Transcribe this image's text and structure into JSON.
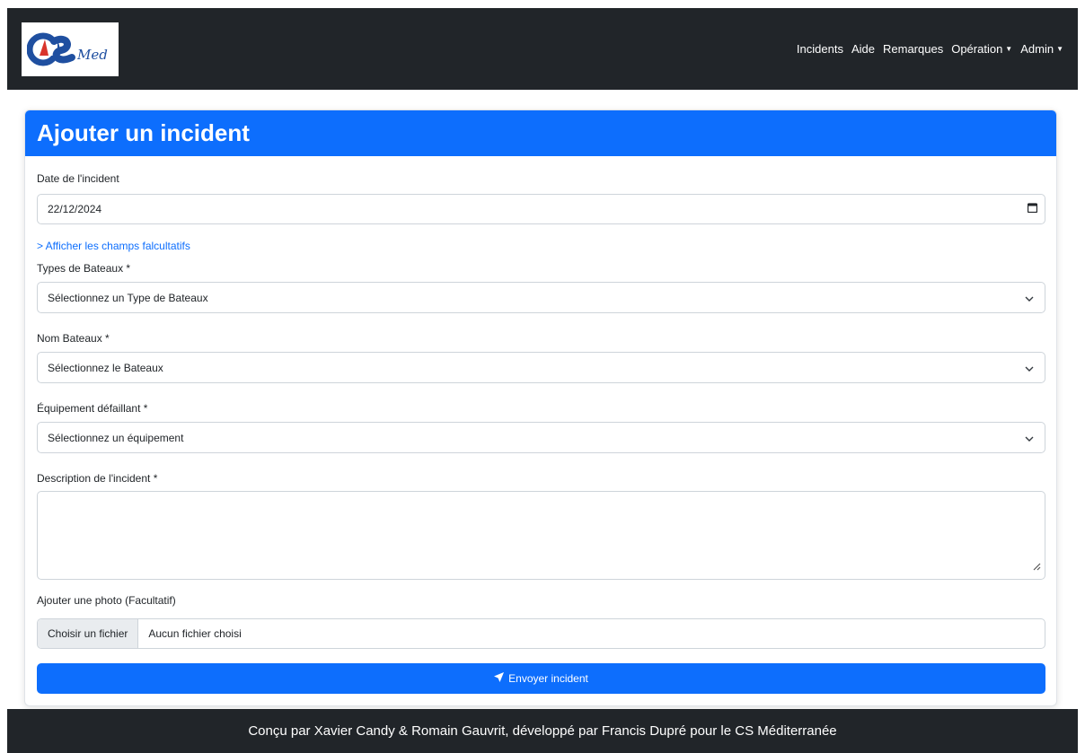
{
  "navbar": {
    "logo_text": "CS Med",
    "links": [
      {
        "label": "Incidents"
      },
      {
        "label": "Aide"
      },
      {
        "label": "Remarques"
      },
      {
        "label": "Opération"
      },
      {
        "label": "Admin"
      }
    ]
  },
  "form": {
    "title": "Ajouter un incident",
    "date_label": "Date de l'incident",
    "date_value": "22/12/2024",
    "optional_link": "> Afficher les champs falcultatifs",
    "boat_type_label": "Types de Bateaux *",
    "boat_type_value": "Sélectionnez un Type de Bateaux",
    "boat_name_label": "Nom Bateaux *",
    "boat_name_value": "Sélectionnez le Bateaux",
    "equipment_label": "Équipement défaillant *",
    "equipment_value": "Sélectionnez un équipement",
    "description_label": "Description de l'incident *",
    "description_value": "",
    "photo_label": "Ajouter une photo (Facultatif)",
    "file_button": "Choisir un fichier",
    "file_status": "Aucun fichier choisi",
    "submit_label": "Envoyer incident"
  },
  "footer": {
    "text": "Conçu par Xavier Candy & Romain Gauvrit, développé par Francis Dupré pour le CS Méditerranée"
  },
  "colors": {
    "primary": "#0d6efd",
    "dark": "#212529"
  }
}
